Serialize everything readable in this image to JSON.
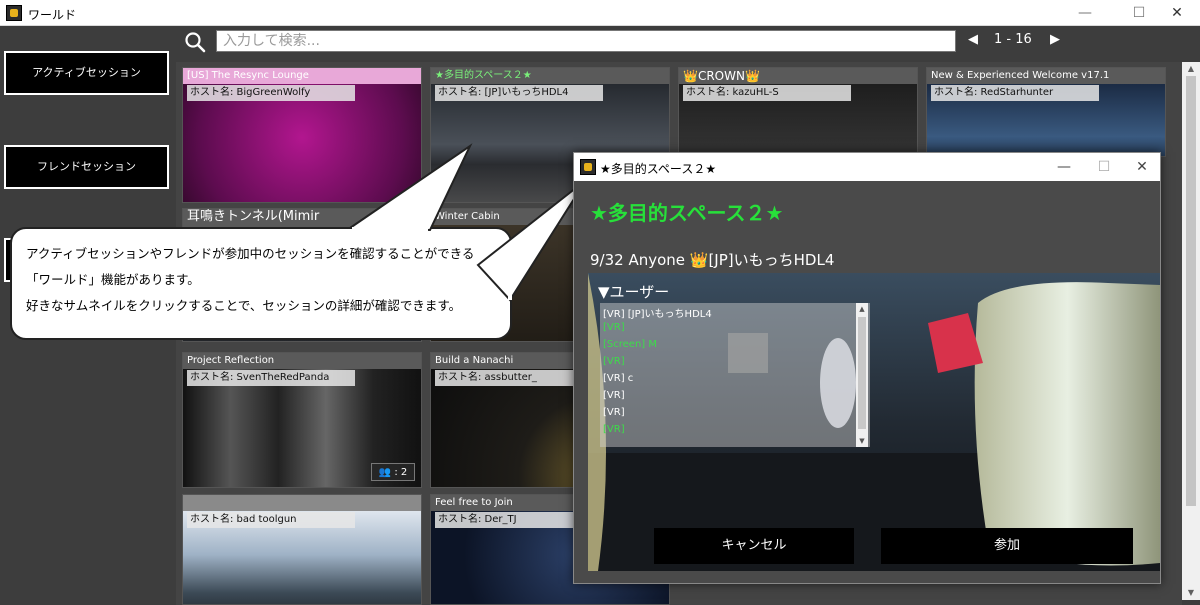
{
  "window": {
    "title": "ワールド",
    "minimize": "—",
    "maximize": "☐",
    "close": "✕"
  },
  "sidebar": {
    "active_sessions": "アクティブセッション",
    "friend_sessions": "フレンドセッション"
  },
  "search": {
    "placeholder": "入力して検索..."
  },
  "pager": {
    "prev": "◀",
    "range": "1 - 16",
    "next": "▶"
  },
  "cards": [
    {
      "title": "[US] The Resync Lounge",
      "host": "ホスト名: BigGreenWolfy",
      "title_color": "#f4b6e6"
    },
    {
      "title": "★多目的スペース２★",
      "host": "ホスト名: [JP]いもっちHDL4",
      "title_color": "#7af07a"
    },
    {
      "title": "👑CROWN👑",
      "host": "ホスト名: kazuHL-S",
      "title_color": "#ffffff"
    },
    {
      "title": "New & Experienced Welcome v17.1",
      "host": "ホスト名: RedStarhunter",
      "title_color": "#ffffff"
    },
    {
      "title": "耳鳴きトンネル(Mimir",
      "host": "",
      "title_color": "#ffffff"
    },
    {
      "title": "Winter Cabin",
      "host": "",
      "title_color": "#ffffff"
    },
    {
      "title": "Project Reflection",
      "host": "ホスト名: SvenTheRedPanda",
      "title_color": "#ffffff",
      "badge": "👥 : 2"
    },
    {
      "title": "Build a Nanachi",
      "host": "ホスト名: assbutter_",
      "title_color": "#ffffff"
    },
    {
      "title": "",
      "host": "ホスト名: bad toolgun",
      "title_color": "#ffffff"
    },
    {
      "title": "Feel free to Join",
      "host": "ホスト名: Der_TJ",
      "title_color": "#ffffff"
    }
  ],
  "bubble": {
    "line1": "アクティブセッションやフレンドが参加中のセッションを確認することができる",
    "line2": "「ワールド」機能があります。",
    "line3": "好きなサムネイルをクリックすることで、セッションの詳細が確認できます。"
  },
  "dialog": {
    "title": "★多目的スペース２★",
    "heading": "★多目的スペース２★",
    "info": "9/32 Anyone 👑[JP]いもっちHDL4",
    "users_label": "▼ユーザー",
    "users": [
      {
        "name": "[VR] [JP]いもっちHDL4",
        "green": false
      },
      {
        "name": "[VR] ",
        "green": true
      },
      {
        "name": "[Screen] M",
        "green": true
      },
      {
        "name": "[VR] ",
        "green": true
      },
      {
        "name": "[VR] c",
        "green": false
      },
      {
        "name": "[VR] ",
        "green": false
      },
      {
        "name": "[VR] ",
        "green": false
      },
      {
        "name": "[VR] ",
        "green": true
      }
    ],
    "cancel": "キャンセル",
    "join": "参加"
  },
  "colors": {
    "accent_green": "#27e03a",
    "background": "#3d3d3d"
  }
}
